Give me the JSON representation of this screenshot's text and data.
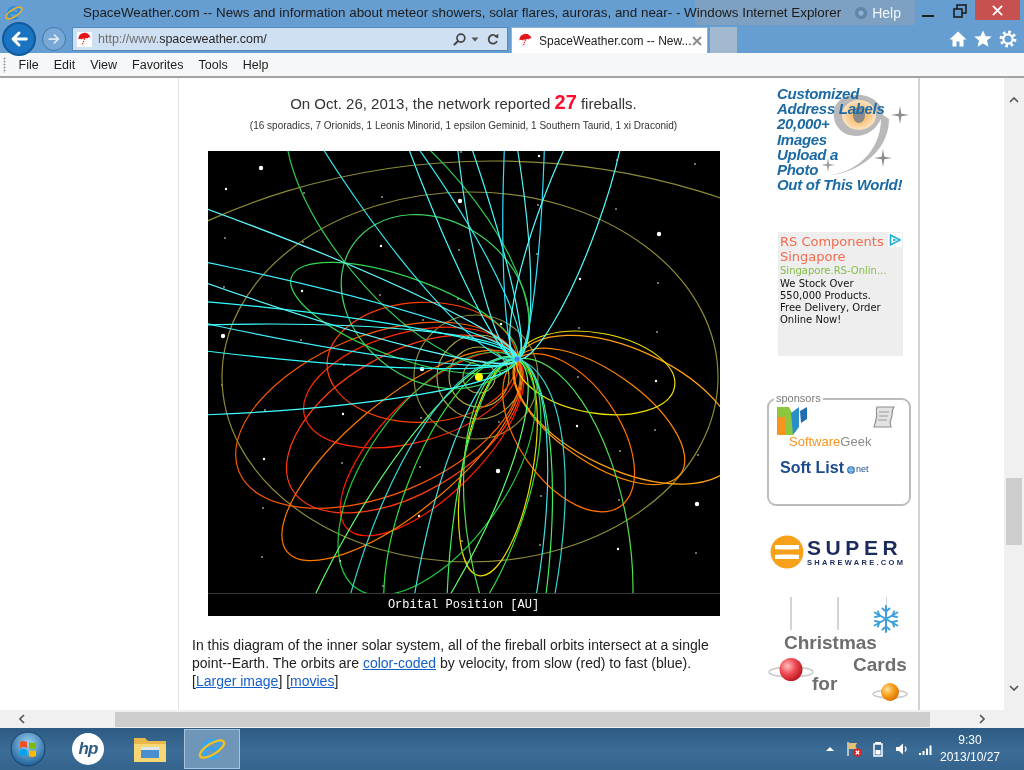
{
  "window": {
    "title": "SpaceWeather.com -- News and information about meteor showers, solar flares, auroras, and near- - Windows Internet Explorer"
  },
  "language_bar": {
    "label": "Help"
  },
  "address_bar": {
    "url_prefix": "http://www.",
    "url_domain": "spaceweather.com/"
  },
  "tabs": [
    {
      "label": "SpaceWeather.com -- New...",
      "selected": true
    }
  ],
  "menu": [
    "File",
    "Edit",
    "View",
    "Favorites",
    "Tools",
    "Help"
  ],
  "article": {
    "headline": "On Oct. 26, 2013, the network reported **27** fireballs.",
    "breakdown": "(16 sporadics, 7 Orionids, 1 Leonis Minorid, 1 epsilon Geminid, 1 Southern Taurid, 1 xi Draconid)",
    "diagram": {
      "caption": "Orbital Position [AU]"
    },
    "description": [
      {
        "kind": "text",
        "text": "In this diagram of the inner solar system, all of the fireball orbits intersect at a single point--Earth. The orbits are "
      },
      {
        "kind": "link",
        "text": "color-coded"
      },
      {
        "kind": "text",
        "text": " by velocity, from slow (red) to fast (blue)."
      },
      {
        "kind": "break"
      },
      {
        "kind": "text",
        "text": "["
      },
      {
        "kind": "link",
        "text": "Larger image"
      },
      {
        "kind": "text",
        "text": "] ["
      },
      {
        "kind": "link",
        "text": "movies"
      },
      {
        "kind": "text",
        "text": "]"
      }
    ]
  },
  "sidebar": {
    "labels_ad": {
      "lines": [
        "Customized",
        "Address Labels",
        "20,000+",
        "Images",
        "Upload a",
        "Photo",
        "Out of This World!"
      ]
    },
    "text_ad": {
      "title": "RS Components Singapore",
      "url": "Singapore.RS-Onlin...",
      "body": "We Stock Over 550,000 Products. Free Delivery, Order Online Now!"
    },
    "sponsors": {
      "legend": "sponsors",
      "items": [
        {
          "kind": "softwaregeek",
          "parts": [
            "Software",
            "Geek"
          ]
        },
        {
          "kind": "softlist",
          "name": "Soft List",
          "suffix": "net"
        }
      ]
    },
    "shareware_ad": {
      "title": "SUPER",
      "subtitle": "SHAREWARE.COM"
    },
    "cards_ad": {
      "lines": [
        "Christmas",
        "Cards",
        "for"
      ]
    }
  },
  "taskbar": {
    "apps": [
      {
        "kind": "hp",
        "label": "hp",
        "selected": false
      },
      {
        "kind": "explorer",
        "selected": false
      },
      {
        "kind": "ie",
        "selected": true
      }
    ],
    "clock": {
      "time": "9:30",
      "date": "2013/10/27"
    }
  }
}
